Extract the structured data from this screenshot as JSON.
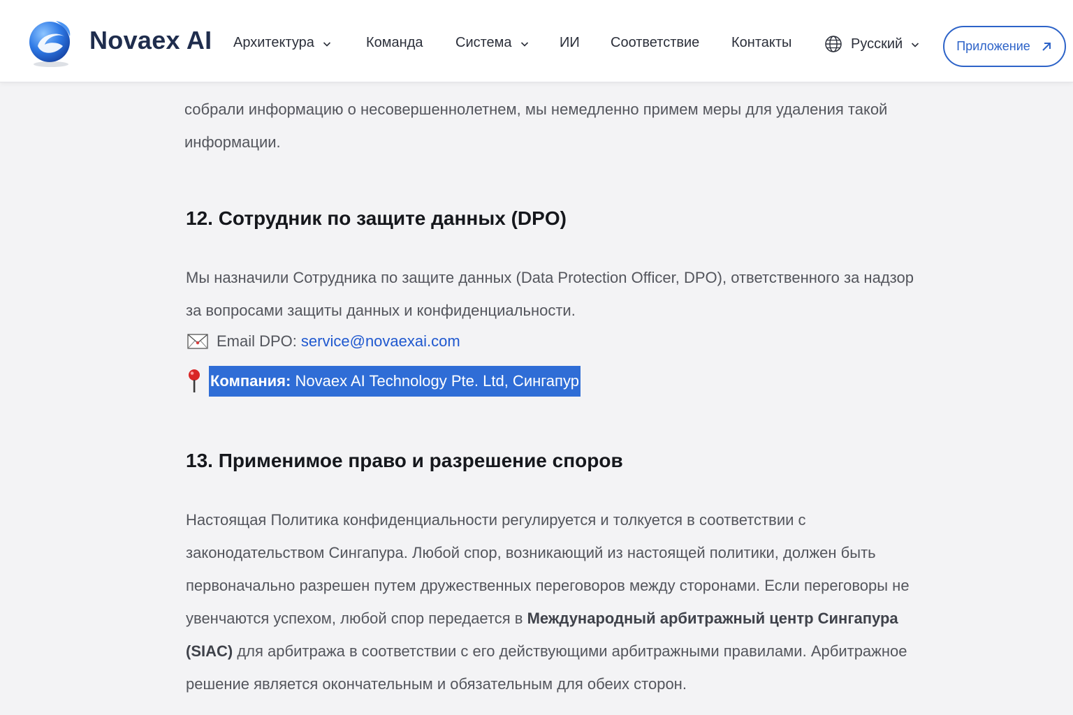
{
  "header": {
    "brand": "Novaex AI",
    "nav": [
      {
        "label": "Архитектура",
        "dropdown": true
      },
      {
        "label": "Команда",
        "dropdown": false
      },
      {
        "label": "Система",
        "dropdown": true
      },
      {
        "label": "ИИ",
        "dropdown": false
      },
      {
        "label": "Соответствие",
        "dropdown": false
      },
      {
        "label": "Контакты",
        "dropdown": false
      }
    ],
    "language": "Русский",
    "app_button": "Приложение",
    "icons": [
      "logo-icon",
      "chevron-down-icon",
      "globe-icon",
      "arrow-up-right-icon"
    ]
  },
  "content": {
    "intro_lines": [
      "собрали информацию о несовершеннолетнем, мы немедленно примем меры для удаления такой",
      "информации."
    ],
    "s12": {
      "title": "12. Сотрудник по защите данных (DPO)",
      "lines": [
        "Мы назначили Сотрудника по защите данных (Data Protection Officer, DPO), ответственного за надзор",
        "за вопросами защиты данных и конфиденциальности."
      ],
      "email_label": "Email DPO: ",
      "email": "service@novaexai.com",
      "company_label": "Компания:",
      "company_value": " Novaex AI Technology Pte. Ltd, Сингапур",
      "icons": [
        "envelope-icon",
        "pin-icon"
      ]
    },
    "s13": {
      "title": "13. Применимое право и разрешение споров",
      "line1": "Настоящая Политика конфиденциальности регулируется и толкуется в соответствии с",
      "line2": "законодательством Сингапура. Любой спор, возникающий из настоящей политики, должен быть",
      "line3": "первоначально разрешен путем дружественных переговоров между сторонами. Если переговоры не",
      "line4_pre": "увенчаются успехом, любой спор передается в ",
      "line4_bold": "Международный арбитражный центр Сингапура",
      "line5_bold": "(SIAC)",
      "line5_post": " для арбитража в соответствии с его действующими арбитражными правилами. Арбитражное",
      "line6": "решение является окончательным и обязательным для обеих сторон."
    }
  },
  "colors": {
    "accent": "#2d63c8",
    "selection": "#2f6dd6",
    "link": "#1f58cf"
  }
}
